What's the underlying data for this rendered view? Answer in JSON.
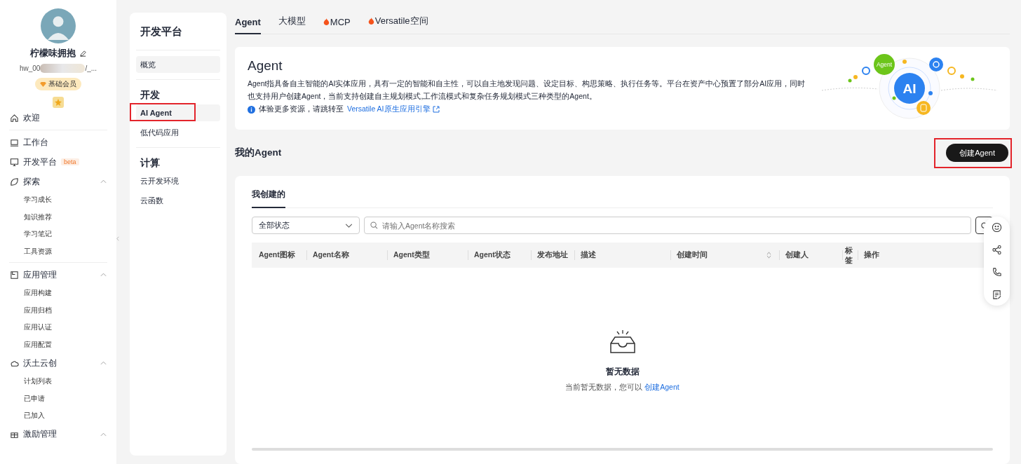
{
  "profile": {
    "name": "柠檬味拥抱",
    "handle_start": "hw_00",
    "handle_end": "/_...",
    "membership": "基础会员"
  },
  "nav": [
    {
      "label": "欢迎",
      "divider_after": true
    },
    {
      "label": "工作台"
    },
    {
      "label": "开发平台",
      "badge": "beta"
    },
    {
      "label": "探索",
      "expanded": true,
      "children": [
        {
          "label": "学习成长"
        },
        {
          "label": "知识推荐"
        },
        {
          "label": "学习笔记"
        },
        {
          "label": "工具资源"
        }
      ],
      "divider_after": true
    },
    {
      "label": "应用管理",
      "expanded": true,
      "children": [
        {
          "label": "应用构建"
        },
        {
          "label": "应用归档"
        },
        {
          "label": "应用认证"
        },
        {
          "label": "应用配置"
        }
      ]
    },
    {
      "label": "沃土云创",
      "expanded": true,
      "children": [
        {
          "label": "计划列表"
        },
        {
          "label": "已申请"
        },
        {
          "label": "已加入"
        }
      ]
    },
    {
      "label": "激励管理",
      "expanded": true
    }
  ],
  "subnav": {
    "title": "开发平台",
    "groups": [
      {
        "kind": "card",
        "items": [
          {
            "label": "概览",
            "selected": false,
            "annotated": false
          }
        ]
      },
      {
        "kind": "list",
        "title": "开发",
        "items": [
          {
            "label": "AI Agent",
            "selected": true,
            "annotated": true
          },
          {
            "label": "低代码应用",
            "selected": false,
            "annotated": false
          }
        ]
      },
      {
        "kind": "list",
        "title": "计算",
        "items": [
          {
            "label": "云开发环境",
            "selected": false,
            "annotated": false
          },
          {
            "label": "云函数",
            "selected": false,
            "annotated": false
          }
        ]
      }
    ]
  },
  "tabs": [
    {
      "label": "Agent",
      "selected": true,
      "hot": false
    },
    {
      "label": "大模型",
      "selected": false,
      "hot": false
    },
    {
      "label": "MCP",
      "selected": false,
      "hot": true
    },
    {
      "label": "Versatile空间",
      "selected": false,
      "hot": true
    }
  ],
  "intro": {
    "title": "Agent",
    "description": "Agent指具备自主智能的AI实体应用，具有一定的智能和自主性，可以自主地发现问题、设定目标、构思策略、执行任务等。平台在资产中心预置了部分AI应用，同时也支持用户创建Agent，当前支持创建自主规划模式,工作流模式和复杂任务规划模式三种类型的Agent。",
    "tip": "体验更多资源，请跳转至",
    "link": "Versatile AI原生应用引擎",
    "illustration": {
      "badge": "Agent",
      "core": "AI"
    }
  },
  "section": {
    "title": "我的Agent",
    "create_button": "创建Agent",
    "button_annotated": true
  },
  "card": {
    "tabs": [
      {
        "label": "我创建的",
        "selected": true
      }
    ],
    "filter": {
      "value": "全部状态"
    },
    "search": {
      "placeholder": "请输入Agent名称搜索"
    },
    "columns": [
      {
        "label": "Agent图标"
      },
      {
        "label": "Agent名称"
      },
      {
        "label": "Agent类型"
      },
      {
        "label": "Agent状态"
      },
      {
        "label": "发布地址"
      },
      {
        "label": "描述"
      },
      {
        "label": "创建时间",
        "sortable": true
      },
      {
        "label": "创建人"
      },
      {
        "label": "标签"
      },
      {
        "label": "操作"
      }
    ],
    "empty": {
      "title": "暂无数据",
      "text": "当前暂无数据，您可以",
      "link": "创建Agent"
    }
  }
}
